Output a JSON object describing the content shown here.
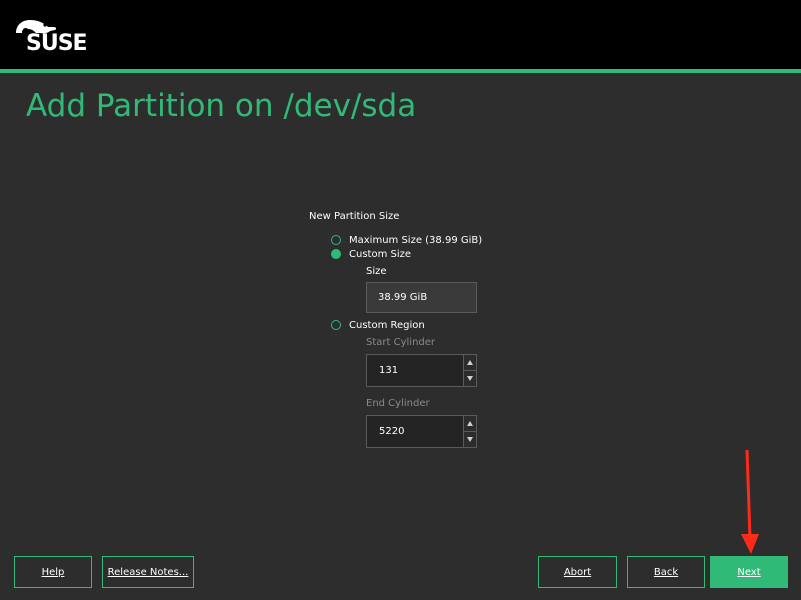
{
  "header": {
    "logo_text": "SUSE",
    "accent_color": "#30ba78"
  },
  "page": {
    "title": "Add Partition on /dev/sda"
  },
  "partition_size": {
    "section_label": "New Partition Size",
    "options": [
      {
        "label": "Maximum Size (38.99 GiB)",
        "checked": false
      },
      {
        "label": "Custom Size",
        "checked": true
      },
      {
        "label": "Custom Region",
        "checked": false
      }
    ],
    "size_label": "Size",
    "size_value": "38.99 GiB",
    "start_cylinder_label": "Start Cylinder",
    "start_cylinder_value": "131",
    "end_cylinder_label": "End Cylinder",
    "end_cylinder_value": "5220"
  },
  "footer": {
    "help_label": "Help",
    "release_notes_label": "Release Notes...",
    "abort_label": "Abort",
    "back_label": "Back",
    "next_label": "Next"
  },
  "annotation": {
    "arrow_color": "#ff2a1a",
    "arrow_icon": "red-arrow-pointing-down"
  }
}
